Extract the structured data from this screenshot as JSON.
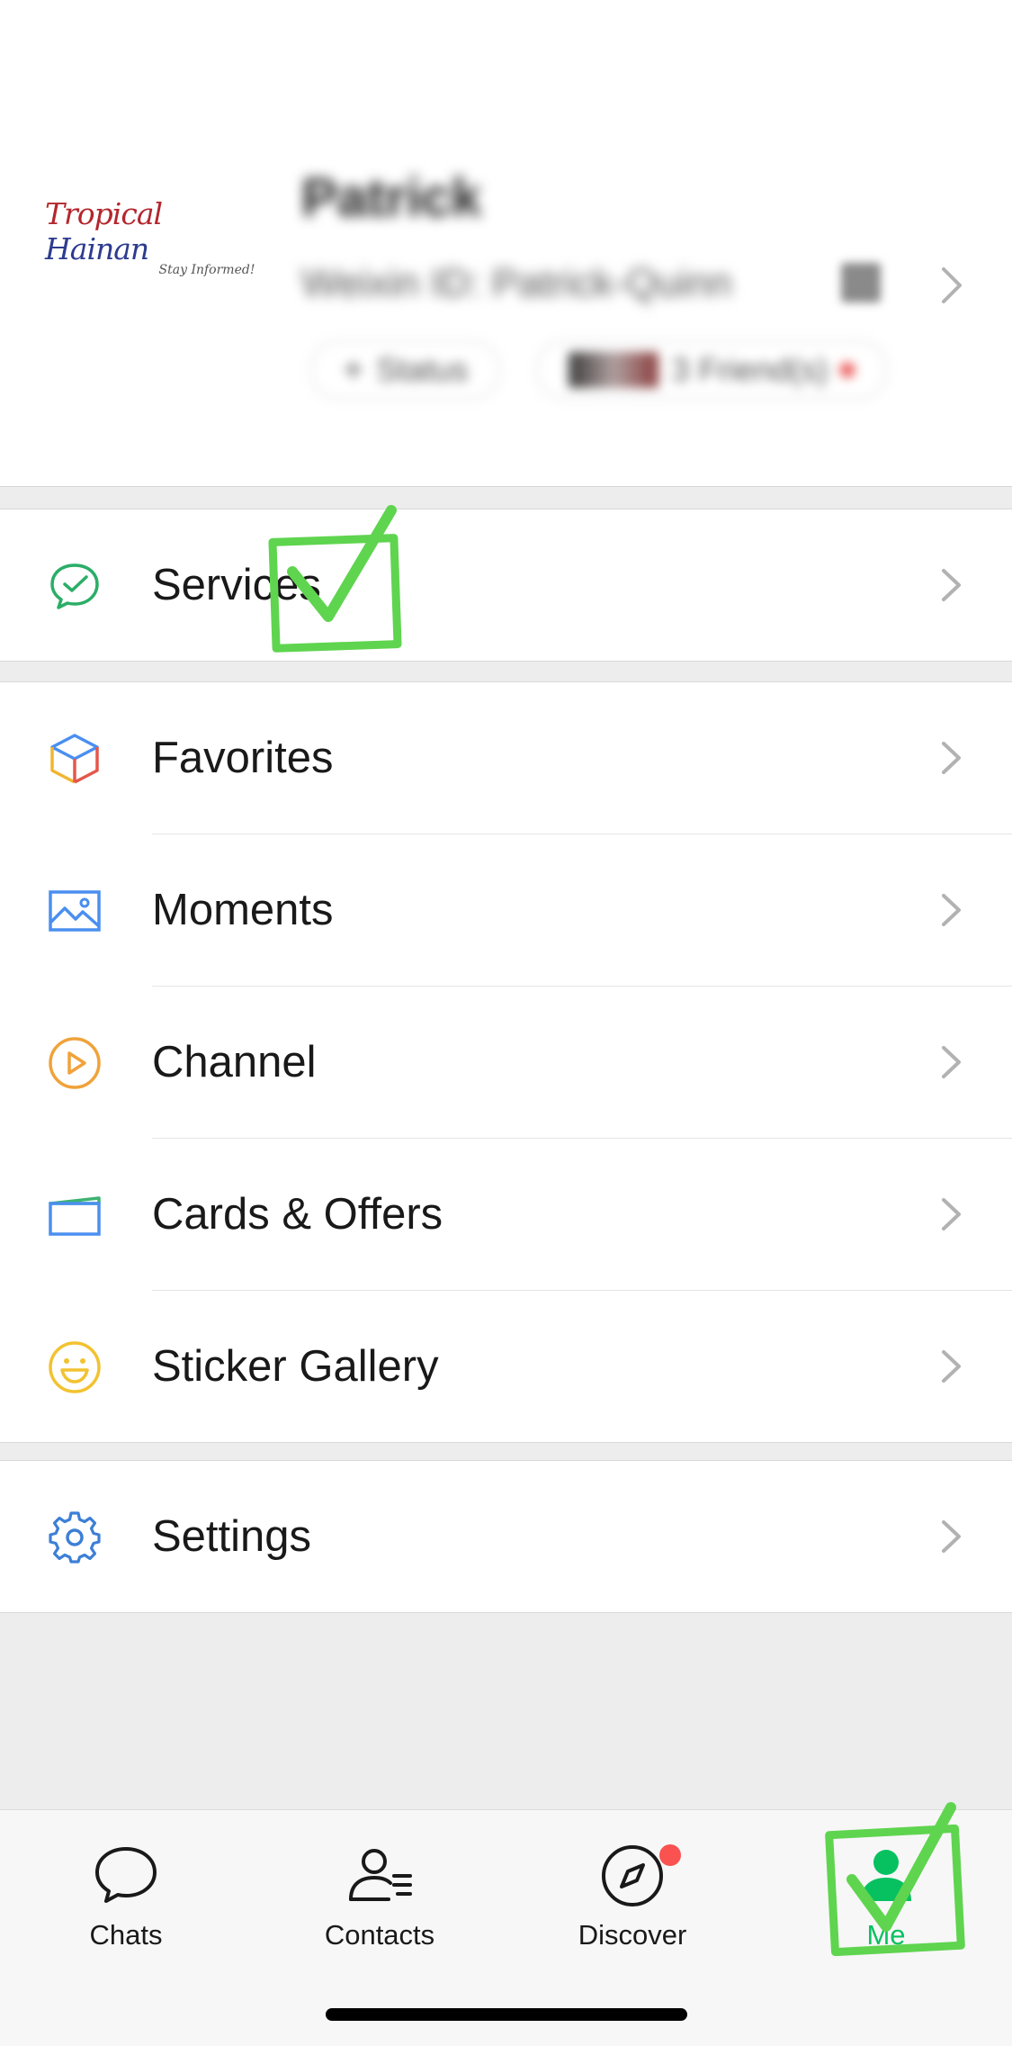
{
  "profile": {
    "logo_main_1": "Tropical",
    "logo_main_2": "Hainan",
    "logo_sub": "Stay Informed!",
    "name": "Patrick",
    "wechat_id": "Weixin ID: Patrick-Quinn",
    "status_label": "Status",
    "friends_label": "3 Friend(s)"
  },
  "menu": {
    "group1": [
      {
        "label": "Services",
        "icon": "services-icon"
      }
    ],
    "group2": [
      {
        "label": "Favorites",
        "icon": "favorites-icon"
      },
      {
        "label": "Moments",
        "icon": "moments-icon"
      },
      {
        "label": "Channel",
        "icon": "channel-icon"
      },
      {
        "label": "Cards & Offers",
        "icon": "cards-offers-icon"
      },
      {
        "label": "Sticker Gallery",
        "icon": "sticker-gallery-icon"
      }
    ],
    "group3": [
      {
        "label": "Settings",
        "icon": "settings-icon"
      }
    ]
  },
  "tabbar": {
    "tabs": [
      {
        "label": "Chats",
        "icon": "chat-bubble-icon"
      },
      {
        "label": "Contacts",
        "icon": "contacts-icon"
      },
      {
        "label": "Discover",
        "icon": "compass-icon",
        "badge": true
      },
      {
        "label": "Me",
        "icon": "person-icon",
        "active": true
      }
    ]
  },
  "colors": {
    "accent_green": "#07c160",
    "annotation_green": "#5fd44f",
    "background": "#ededed",
    "badge_red": "#fa5151"
  }
}
